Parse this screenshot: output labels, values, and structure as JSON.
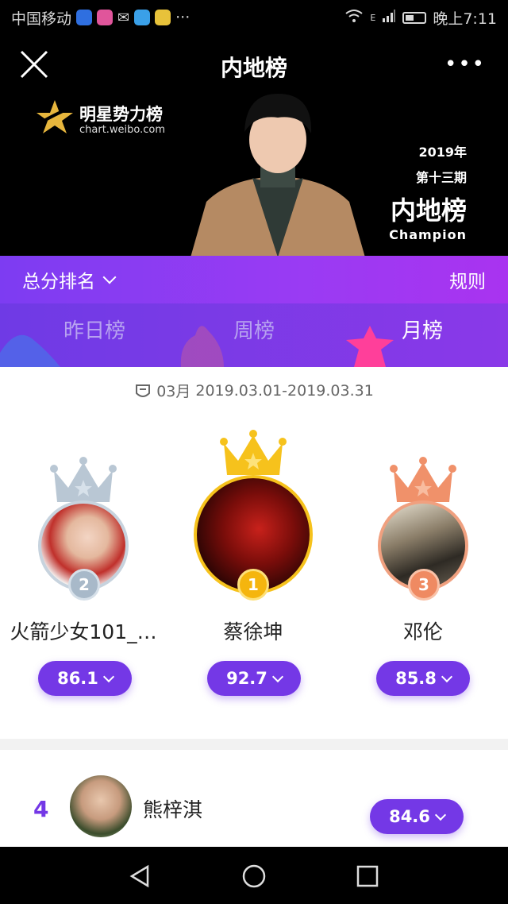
{
  "status_bar": {
    "carrier": "中国移动",
    "network": "E",
    "time": "晚上7:11",
    "dots": "···"
  },
  "header": {
    "title": "内地榜",
    "more": "•••"
  },
  "banner": {
    "logo_title": "明星势力榜",
    "logo_url": "chart.weibo.com",
    "issue_year": "2019年",
    "issue_number": "第十三期",
    "issue_board": "内地榜",
    "issue_champion": "Champion"
  },
  "ranking_bar": {
    "sort_label": "总分排名",
    "rules_label": "规则"
  },
  "tabs": [
    {
      "label": "昨日榜",
      "active": false
    },
    {
      "label": "周榜",
      "active": false
    },
    {
      "label": "月榜",
      "active": true
    }
  ],
  "period": {
    "month": "03月",
    "range": "2019.03.01-2019.03.31"
  },
  "podium": [
    {
      "rank": "2",
      "name": "火箭少女101_…",
      "score": "86.1",
      "color": "#b9c7d4"
    },
    {
      "rank": "1",
      "name": "蔡徐坤",
      "score": "92.7",
      "color": "#f6c21c"
    },
    {
      "rank": "3",
      "name": "邓伦",
      "score": "85.8",
      "color": "#f0916a"
    }
  ],
  "list": [
    {
      "rank": "4",
      "name": "熊梓淇",
      "score": "84.6"
    }
  ],
  "colors": {
    "accent": "#7438e6",
    "gold": "#f6c21c",
    "silver": "#b9c7d4",
    "bronze": "#f0916a"
  }
}
